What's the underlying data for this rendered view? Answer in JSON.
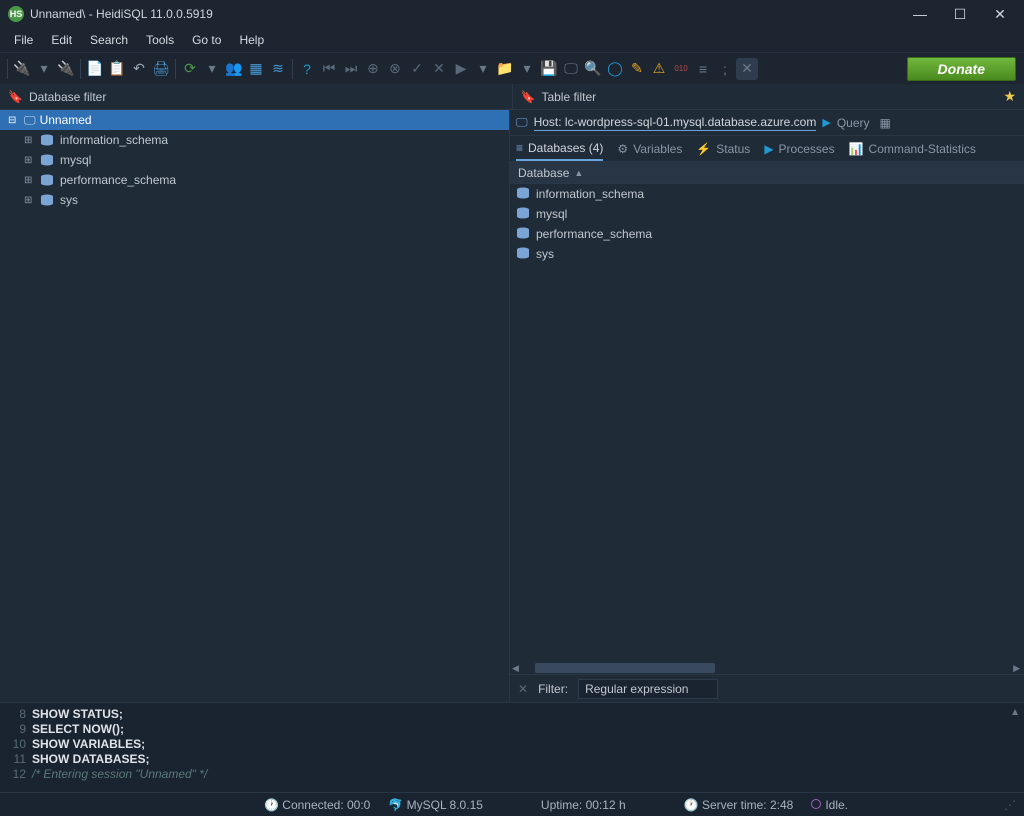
{
  "titlebar": {
    "title": "Unnamed\\ - HeidiSQL 11.0.0.5919"
  },
  "menubar": [
    "File",
    "Edit",
    "Search",
    "Tools",
    "Go to",
    "Help"
  ],
  "donate": "Donate",
  "filters": {
    "db": "Database filter",
    "table": "Table filter"
  },
  "tree": {
    "session": "Unnamed",
    "children": [
      "information_schema",
      "mysql",
      "performance_schema",
      "sys"
    ]
  },
  "host": {
    "label": "Host: lc-wordpress-sql-01.mysql.database.azure.com",
    "query": "Query"
  },
  "tabs": {
    "databases": {
      "label": "Databases",
      "count": 4
    },
    "variables": "Variables",
    "status": "Status",
    "processes": "Processes",
    "stats": "Command-Statistics"
  },
  "db_header": "Database",
  "databases": [
    "information_schema",
    "mysql",
    "performance_schema",
    "sys"
  ],
  "filter": {
    "label": "Filter:",
    "value": "Regular expression"
  },
  "log": [
    {
      "ln": "8",
      "text": "SHOW STATUS;",
      "kw": true
    },
    {
      "ln": "9",
      "text": "SELECT NOW();",
      "kw": true
    },
    {
      "ln": "10",
      "text": "SHOW VARIABLES;",
      "kw": true
    },
    {
      "ln": "11",
      "text": "SHOW DATABASES;",
      "kw": true
    },
    {
      "ln": "12",
      "text": "/* Entering session \"Unnamed\" */",
      "kw": false
    }
  ],
  "status": {
    "connected": "Connected: 00:0",
    "server": "MySQL 8.0.15",
    "uptime": "Uptime: 00:12 h",
    "servertime": "Server time: 2:48",
    "idle": "Idle."
  }
}
